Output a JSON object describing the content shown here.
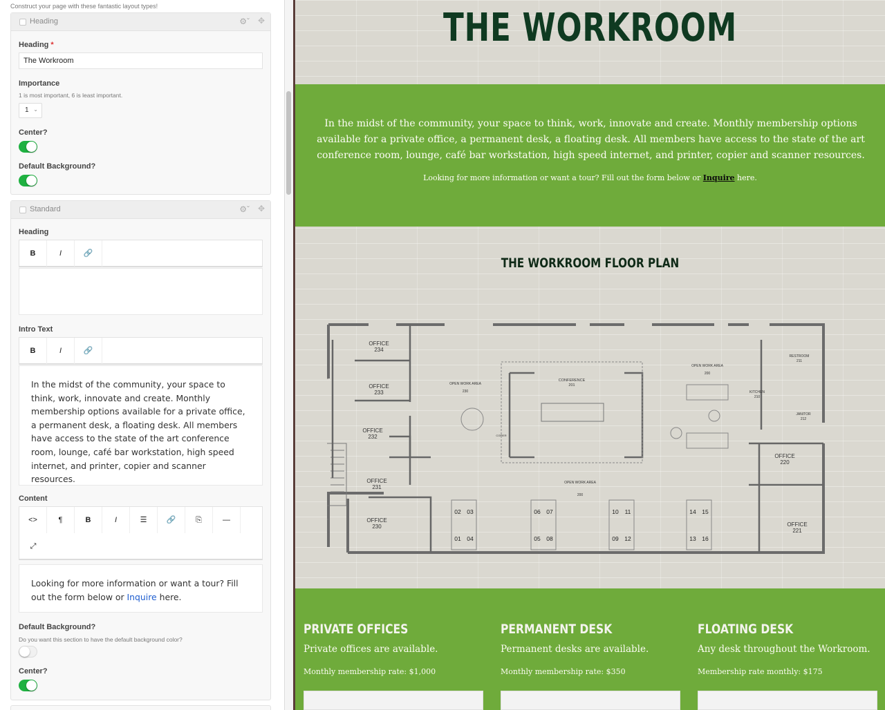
{
  "editor": {
    "top_hint": "Construct your page with these fantastic layout types!",
    "heading_block": {
      "title": "Heading",
      "heading_label": "Heading",
      "required_mark": "*",
      "heading_value": "The Workroom",
      "importance_label": "Importance",
      "importance_help": "1 is most important, 6 is least important.",
      "importance_value": "1",
      "center_label": "Center?",
      "center_on": true,
      "default_bg_label": "Default Background?",
      "default_bg_on": true
    },
    "standard_block": {
      "title": "Standard",
      "heading_label": "Heading",
      "intro_label": "Intro Text",
      "intro_text": "In the midst of the community, your space to think, work, innovate and create. Monthly membership options available for a private office, a permanent desk, a floating desk. All members have access to the state of the art conference room, lounge, café bar workstation, high speed internet, and printer, copier and scanner resources.",
      "content_label": "Content",
      "content_before": "Looking for more information or want a tour? Fill out the form below or ",
      "content_link": "Inquire",
      "content_after": " here.",
      "default_bg_label": "Default Background?",
      "default_bg_help": "Do you want this section to have the default background color?",
      "default_bg_on": false,
      "center_label": "Center?",
      "center_on": true
    },
    "toolbar": {
      "bold": "B",
      "italic": "I",
      "link": "🔗",
      "code": "<>",
      "paragraph": "¶",
      "list": "☰",
      "embed": "⎘",
      "hr": "—",
      "expand": "⤢"
    }
  },
  "preview": {
    "title": "THE WORKROOM",
    "intro": "In the midst of the community, your space to think, work, innovate and create. Monthly membership options available for a private office, a permanent desk, a floating desk. All members have access to the state of the art conference room, lounge, café bar workstation, high speed internet, and printer, copier and scanner resources.",
    "inquire_before": "Looking for more information or want a tour? Fill out the form below or ",
    "inquire_link": "Inquire",
    "inquire_after": " here.",
    "plan_title": "THE WORKROOM FLOOR PLAN",
    "plan_labels": {
      "office234": "OFFICE",
      "num234": "234",
      "office233": "OFFICE",
      "num233": "233",
      "office232": "OFFICE",
      "num232": "232",
      "office231": "OFFICE",
      "num231": "231",
      "office230": "OFFICE",
      "num230": "230",
      "office220": "OFFICE",
      "num220": "220",
      "office221": "OFFICE",
      "num221": "221",
      "conference": "CONFERENCE",
      "num201": "201",
      "openwork1": "OPEN WORK AREA",
      "num230b": "230",
      "openwork2": "OPEN WORK AREA",
      "num200": "200",
      "openwork3": "OPEN WORK AREA",
      "num200b": "200",
      "restroom": "RESTROOM",
      "num211": "211",
      "kitchen": "KITCHEN",
      "num210": "210",
      "janitor": "JANITOR",
      "num212": "212",
      "copier": "COPIER",
      "desks": [
        "02",
        "03",
        "01",
        "04",
        "06",
        "07",
        "05",
        "08",
        "10",
        "11",
        "09",
        "12",
        "14",
        "15",
        "13",
        "16"
      ]
    },
    "columns": [
      {
        "heading": "PRIVATE OFFICES",
        "desc": "Private offices are available.",
        "rate": "Monthly membership rate: $1,000"
      },
      {
        "heading": "PERMANENT DESK",
        "desc": "Permanent desks are available.",
        "rate": "Monthly membership rate: $350"
      },
      {
        "heading": "FLOATING DESK",
        "desc": "Any desk throughout the Workroom.",
        "rate": "Membership rate monthly: $175"
      }
    ],
    "colors": {
      "green": "#6fab3b",
      "title": "#0f3a21",
      "wall": "#dad8d0"
    }
  }
}
